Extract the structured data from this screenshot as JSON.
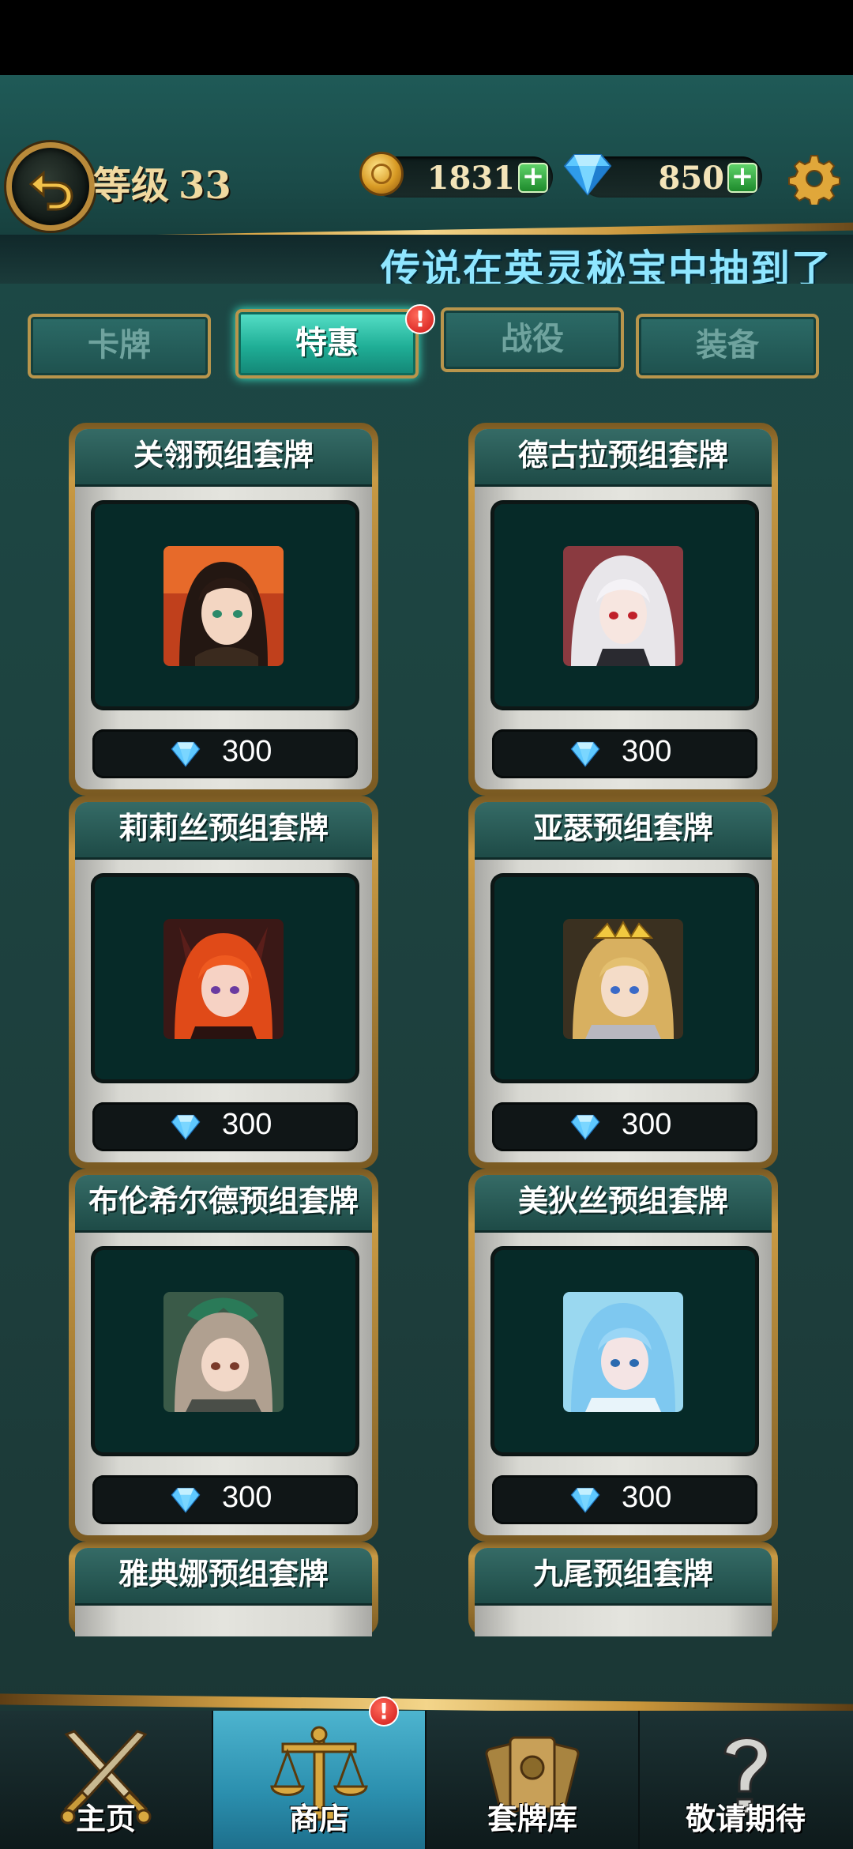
{
  "header": {
    "level_label": "等级",
    "level_value": "33",
    "coins": "1831",
    "gems": "850",
    "ticker": "传说在英灵秘宝中抽到了"
  },
  "tabs": [
    {
      "label": "卡牌",
      "active": false
    },
    {
      "label": "特惠",
      "active": true,
      "badge": "!"
    },
    {
      "label": "战役",
      "active": false
    },
    {
      "label": "装备",
      "active": false
    }
  ],
  "cards": [
    {
      "title": "关翎预组套牌",
      "price": "300"
    },
    {
      "title": "德古拉预组套牌",
      "price": "300"
    },
    {
      "title": "莉莉丝预组套牌",
      "price": "300"
    },
    {
      "title": "亚瑟预组套牌",
      "price": "300"
    },
    {
      "title": "布伦希尔德预组套牌",
      "price": "300"
    },
    {
      "title": "美狄丝预组套牌",
      "price": "300"
    },
    {
      "title": "雅典娜预组套牌"
    },
    {
      "title": "九尾预组套牌"
    }
  ],
  "nav": [
    {
      "label": "主页",
      "icon": "crossed-swords-icon"
    },
    {
      "label": "商店",
      "icon": "scales-icon",
      "active": true,
      "badge": "!"
    },
    {
      "label": "套牌库",
      "icon": "cards-icon"
    },
    {
      "label": "敬请期待",
      "icon": "question-icon"
    }
  ],
  "colors": {
    "accent_gold": "#c99a44",
    "active_tab": "#1fae96",
    "active_nav": "#2b8fae",
    "gem_blue": "#4db8ff",
    "badge_red": "#d01616"
  }
}
